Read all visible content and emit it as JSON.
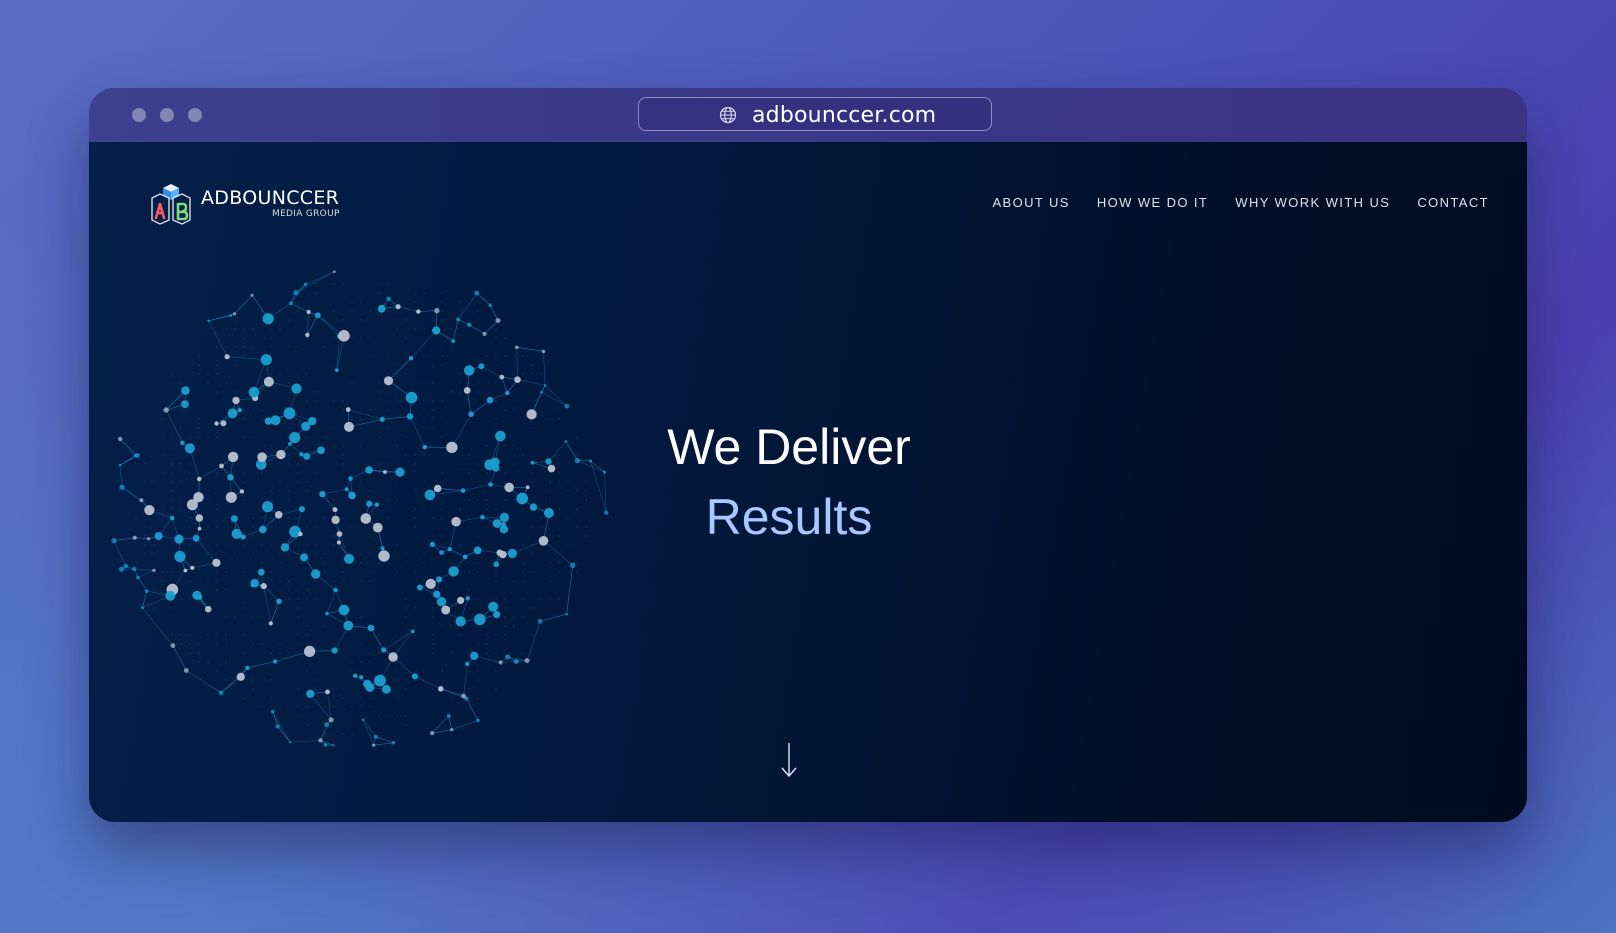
{
  "browser": {
    "url": "adbounccer.com",
    "icons": {
      "url_icon": "globe-icon"
    }
  },
  "site": {
    "logo": {
      "name": "ADBOUNCCER",
      "sub": "MEDIA GROUP",
      "icon": "abc-blocks-logo"
    },
    "nav": [
      "ABOUT US",
      "HOW WE DO IT",
      "WHY WORK WITH US",
      "CONTACT"
    ],
    "hero": {
      "line1": "We Deliver",
      "line2": "Results"
    },
    "scroll_icon": "arrow-down-icon"
  },
  "colors": {
    "hero_accent": "#a9c8ff",
    "globe_node_teal": "#1a9fd0",
    "globe_node_grey": "#b8c2d2",
    "site_background": "#021531"
  }
}
